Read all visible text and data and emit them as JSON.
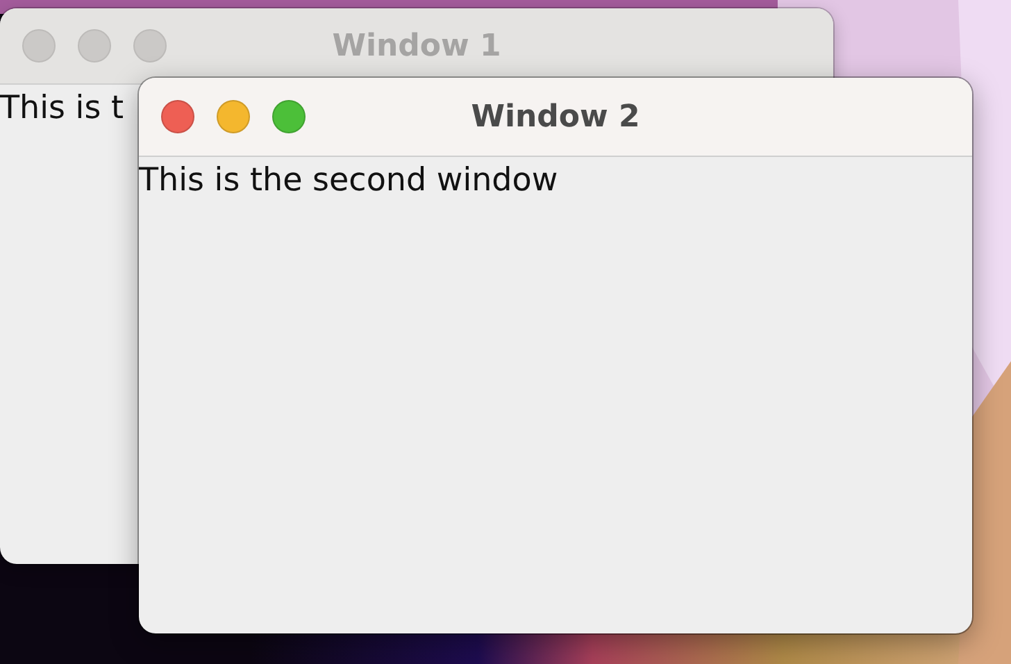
{
  "windows": [
    {
      "title": "Window 1",
      "active": false,
      "text": "This is t"
    },
    {
      "title": "Window 2",
      "active": true,
      "text": "This is the second window"
    }
  ]
}
